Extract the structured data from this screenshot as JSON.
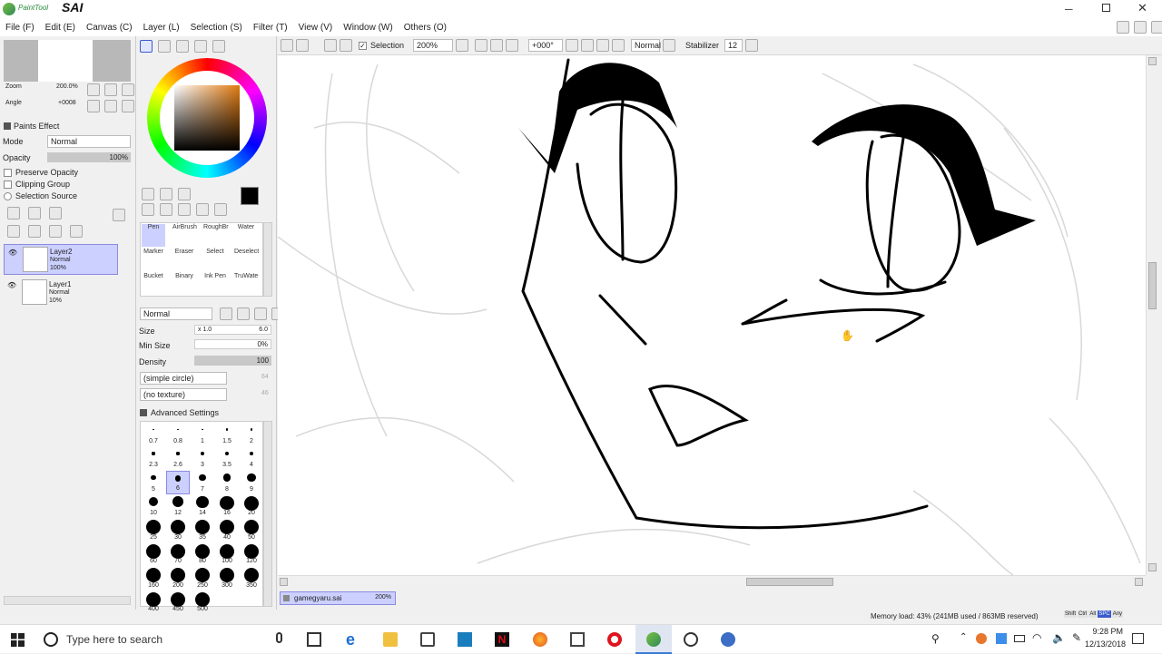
{
  "app": {
    "name": "PaintTool SAI",
    "logo_small": "PaintTool",
    "logo_big": "SAI"
  },
  "menu": [
    "File (F)",
    "Edit (E)",
    "Canvas (C)",
    "Layer (L)",
    "Selection (S)",
    "Filter (T)",
    "View (V)",
    "Window (W)",
    "Others (O)"
  ],
  "toolbar": {
    "selection_label": "Selection",
    "selection_checked": true,
    "zoom": "200%",
    "angle": "+000°",
    "blend": "Normal",
    "stabilizer_label": "Stabilizer",
    "stabilizer_value": "12"
  },
  "navigator": {
    "zoom_label": "Zoom",
    "zoom_value": "200.0%",
    "angle_label": "Angle",
    "angle_value": "+0008"
  },
  "layer_props": {
    "paints_effect": "Paints Effect",
    "mode_label": "Mode",
    "mode_value": "Normal",
    "opacity_label": "Opacity",
    "opacity_value": "100%",
    "preserve_opacity": "Preserve Opacity",
    "clipping_group": "Clipping Group",
    "selection_source": "Selection Source"
  },
  "layers": [
    {
      "name": "Layer2",
      "mode": "Normal",
      "opacity": "100%",
      "selected": true
    },
    {
      "name": "Layer1",
      "mode": "Normal",
      "opacity": "10%",
      "selected": false
    }
  ],
  "brushes": [
    {
      "label": "Pen",
      "selected": true
    },
    {
      "label": "AirBrush"
    },
    {
      "label": "RoughBr"
    },
    {
      "label": "Water"
    },
    {
      "label": "Marker"
    },
    {
      "label": "Eraser"
    },
    {
      "label": "Select"
    },
    {
      "label": "Deselect"
    },
    {
      "label": "Bucket"
    },
    {
      "label": "Binary"
    },
    {
      "label": "Ink Pen"
    },
    {
      "label": "TruWate"
    }
  ],
  "brush_settings": {
    "blend": "Normal",
    "size_label": "Size",
    "size_mult": "x 1.0",
    "size_value": "6.0",
    "minsize_label": "Min Size",
    "minsize_value": "0%",
    "density_label": "Density",
    "density_value": "100",
    "shape": "(simple circle)",
    "shape_value": "64",
    "texture": "(no texture)",
    "texture_value": "46",
    "advanced": "Advanced Settings"
  },
  "brush_sizes": [
    "0.7",
    "0.8",
    "1",
    "1.5",
    "2",
    "2.3",
    "2.6",
    "3",
    "3.5",
    "4",
    "5",
    "6",
    "7",
    "8",
    "9",
    "10",
    "12",
    "14",
    "16",
    "20",
    "25",
    "30",
    "35",
    "40",
    "50",
    "60",
    "70",
    "80",
    "100",
    "120",
    "160",
    "200",
    "250",
    "300",
    "350",
    "400",
    "450",
    "500"
  ],
  "selected_size": "6",
  "document": {
    "name": "gamegyaru.sai",
    "zoom": "200%"
  },
  "status": {
    "memory": "Memory load: 43% (241MB used / 863MB reserved)",
    "keys": [
      "Shift",
      "Ctrl",
      "Alt",
      "SPC",
      "Any"
    ]
  },
  "taskbar": {
    "search_placeholder": "Type here to search",
    "time": "9:28 PM",
    "date": "12/13/2018"
  },
  "colors": {
    "accent": "#3a5bcd",
    "layer_selected": "#ccd0ff",
    "primary": "#000000"
  }
}
